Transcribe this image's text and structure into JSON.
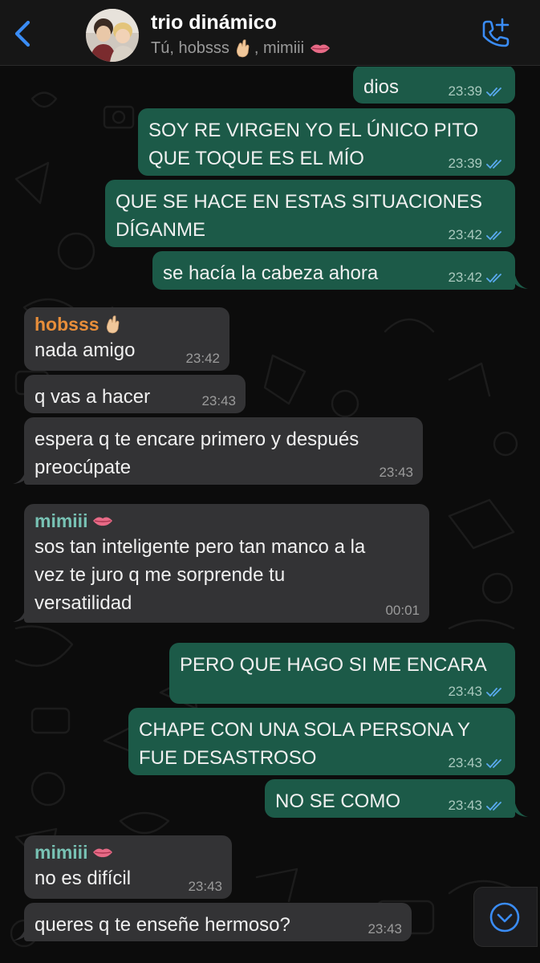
{
  "header": {
    "title": "trio dinámico",
    "subtitle_prefix": "Tú, hobsss",
    "subtitle_sep": ", mimiii",
    "icons": [
      "back-chevron-icon",
      "group-avatar",
      "add-call-icon"
    ]
  },
  "colors": {
    "accent": "#3a8cf5",
    "outgoing_bubble": "#1c5a48",
    "incoming_bubble": "#333335",
    "sender_hobsss": "#e88e3a",
    "sender_mimiii": "#78c2b4",
    "read_ticks": "#5aaaf0"
  },
  "messages": [
    {
      "dir": "out",
      "text": "dios",
      "time": "23:39"
    },
    {
      "dir": "out",
      "text": "SOY RE VIRGEN YO EL ÚNICO PITO\nQUE TOQUE ES EL MÍO",
      "time": "23:39"
    },
    {
      "dir": "out",
      "text": "QUE SE HACE EN ESTAS SITUACIONES\nDÍGANME",
      "time": "23:42"
    },
    {
      "dir": "out",
      "text": "se hacía la cabeza ahora",
      "time": "23:42"
    },
    {
      "dir": "in",
      "sender": "hobsss",
      "sender_emoji": "fingers-crossed-emoji",
      "text": "nada amigo",
      "time": "23:42"
    },
    {
      "dir": "in",
      "text": "q vas a hacer",
      "time": "23:43"
    },
    {
      "dir": "in",
      "text": "espera q te encare primero y después\npreocúpate",
      "time": "23:43"
    },
    {
      "dir": "in",
      "sender": "mimiii",
      "sender_emoji": "lips-emoji",
      "text": "sos tan inteligente pero tan manco a la\nvez te juro q me sorprende tu\nversatilidad",
      "time": "00:01"
    },
    {
      "dir": "out",
      "text": "PERO QUE HAGO SI ME ENCARA",
      "time": "23:43"
    },
    {
      "dir": "out",
      "text": "CHAPE CON UNA SOLA PERSONA Y\nFUE DESASTROSO",
      "time": "23:43"
    },
    {
      "dir": "out",
      "text": "NO SE COMO",
      "time": "23:43"
    },
    {
      "dir": "in",
      "sender": "mimiii",
      "sender_emoji": "lips-emoji",
      "text": "no es difícil",
      "time": "23:43"
    },
    {
      "dir": "in",
      "text": "queres q te enseñe hermoso?",
      "time": "23:43"
    }
  ],
  "scroll_button": "scroll-down-chevron-icon"
}
